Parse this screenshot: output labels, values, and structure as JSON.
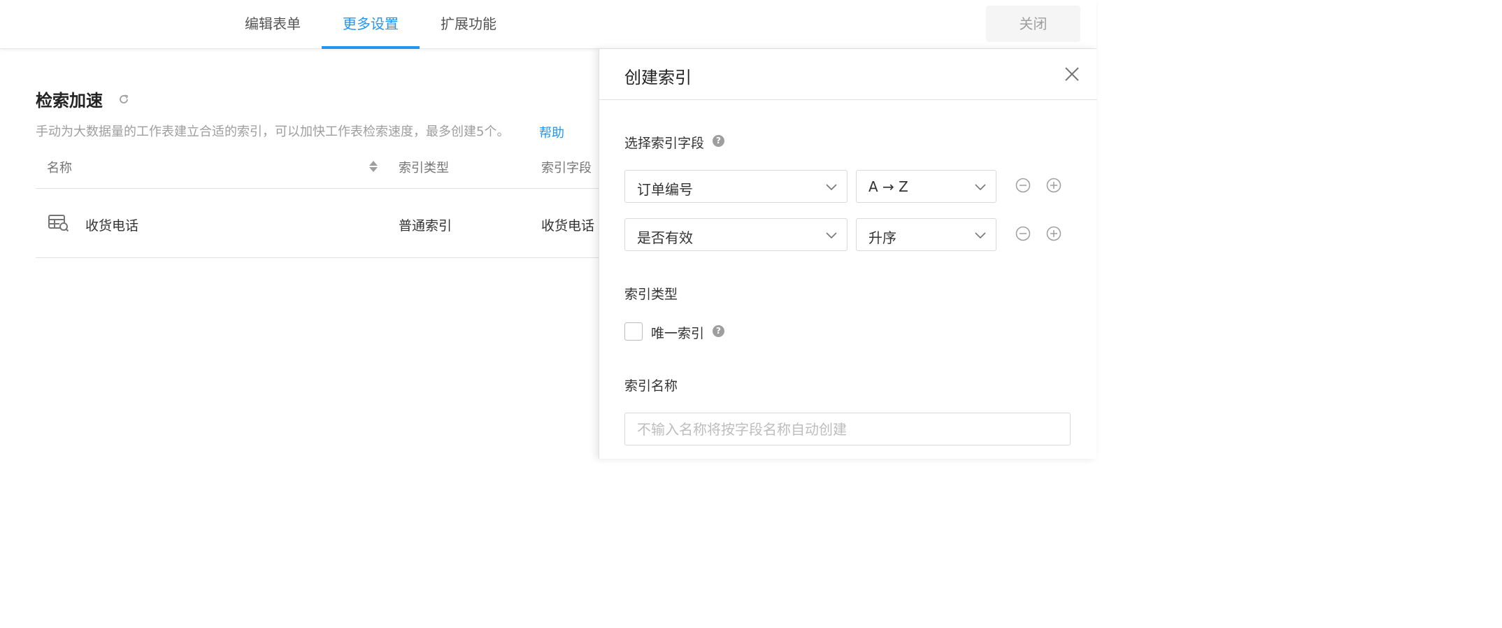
{
  "nav": {
    "tabs": [
      {
        "label": "编辑表单"
      },
      {
        "label": "更多设置"
      },
      {
        "label": "扩展功能"
      }
    ],
    "close_label": "关闭"
  },
  "colors": {
    "accent": "#2196f3",
    "muted_text": "#9e9e9e",
    "border": "#e0e0e0"
  },
  "main": {
    "title": "检索加速",
    "description": "手动为大数据量的工作表建立合适的索引，可以加快工作表检索速度，最多创建5个。",
    "help_link": "帮助",
    "table": {
      "columns": [
        "名称",
        "索引类型",
        "索引字段"
      ],
      "rows": [
        {
          "name": "收货电话",
          "type": "普通索引",
          "field": "收货电话"
        }
      ]
    }
  },
  "drawer": {
    "title": "创建索引",
    "fields_label": "选择索引字段",
    "fields": [
      {
        "field": "订单编号",
        "order": "A → Z"
      },
      {
        "field": "是否有效",
        "order": "升序"
      }
    ],
    "type_label": "索引类型",
    "unique_label": "唯一索引",
    "unique_checked": false,
    "name_label": "索引名称",
    "name_placeholder": "不输入名称将按字段名称自动创建",
    "name_value": ""
  }
}
